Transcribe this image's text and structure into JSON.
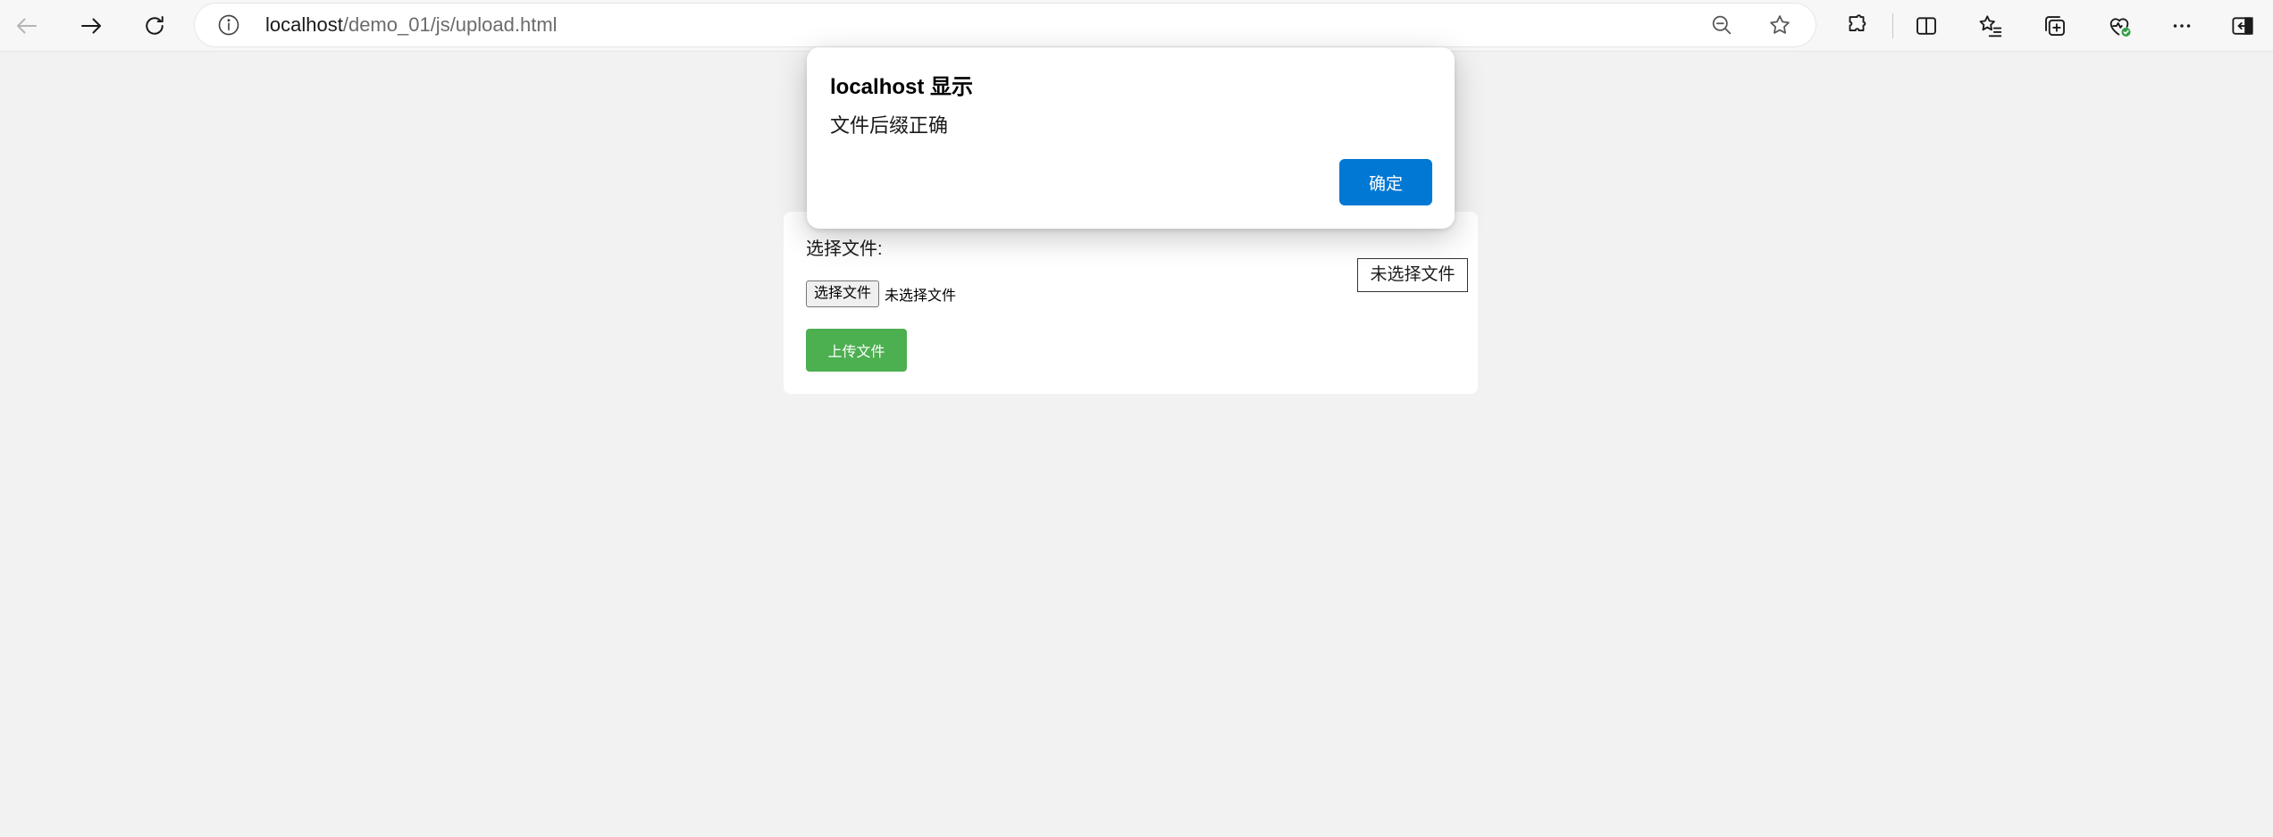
{
  "browser": {
    "url_host": "localhost",
    "url_path": "/demo_01/js/upload.html",
    "icons": [
      "back-icon",
      "forward-icon",
      "refresh-icon",
      "info-icon",
      "zoom-out-icon",
      "favorite-star-icon",
      "extensions-icon",
      "split-screen-icon",
      "favorites-icon",
      "collections-icon",
      "browser-essentials-icon",
      "more-icon",
      "sidebar-toggle-icon"
    ]
  },
  "upload_form": {
    "label": "选择文件:",
    "file_status_box": "未选择文件",
    "choose_button": "选择文件",
    "no_file_text": "未选择文件",
    "upload_button": "上传文件",
    "upload_button_color": "#4caf50"
  },
  "dialog": {
    "title": "localhost 显示",
    "message": "文件后缀正确",
    "ok_button": "确定",
    "ok_button_color": "#0078d4"
  }
}
